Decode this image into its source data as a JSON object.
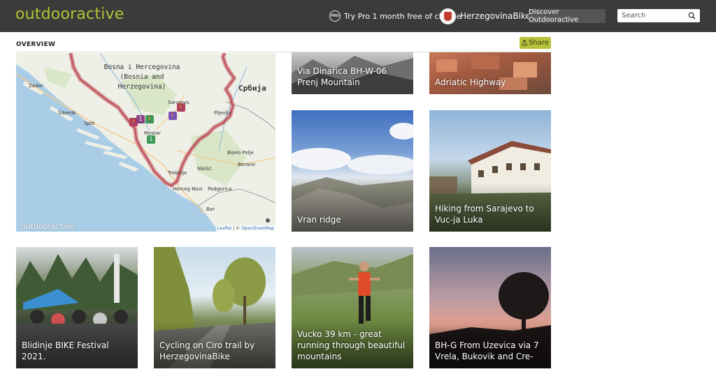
{
  "header": {
    "logo": "outdooractive",
    "pro_badge": "PRO",
    "pro_text": "Try Pro 1 month free of charge",
    "user_name": "HerzegovinaBike",
    "discover_label": "Discover Outdooractive",
    "search_placeholder": "Search"
  },
  "overview": {
    "title": "OVERVIEW",
    "share_label": "Share"
  },
  "map": {
    "country_title": "Bosna i Hercegovina\n(Bosnia and\nHerzegovina)",
    "serbia_label": "Србија",
    "watermark": "outdooractive",
    "attribution_leaflet": "Leaflet",
    "attribution_sep": " | © ",
    "attribution_osm": "OpenStreetMap",
    "places": {
      "zadar": "Zadar",
      "sibenik": "Šibenik",
      "split": "Split",
      "mostar": "Mostar",
      "sarajevo": "Sarajevo",
      "pljevlja": "Pljevlja",
      "bijelo_polje": "Bijelo Polje",
      "berane": "Berane",
      "trebinje": "Trebinje",
      "niksic": "Nikšić",
      "herceg_novi": "Herceg Novi",
      "podgorica": "Podgorica",
      "bar": "Bar"
    }
  },
  "colors": {
    "topbar": "#3b3b3b",
    "brand": "#b3c233",
    "share": "#b5c23a",
    "border_line": "#c0454f"
  },
  "cards": [
    {
      "title": "Via Dinarica BH-W-06 Prenj Mountain"
    },
    {
      "title": "Adriatic Highway"
    },
    {
      "title": "Vran ridge"
    },
    {
      "title": "Hiking from Sarajevo to Vuc-ja Luka"
    },
    {
      "title": "Blidinje BIKE Festival 2021."
    },
    {
      "title": "Cycling on Ciro trail by HerzegovinaBike"
    },
    {
      "title": "Vucko 39 km - great running through beautiful mountains"
    },
    {
      "title": "BH-G From Uzevica via 7 Vrela, Bukovik and Cre-"
    }
  ]
}
